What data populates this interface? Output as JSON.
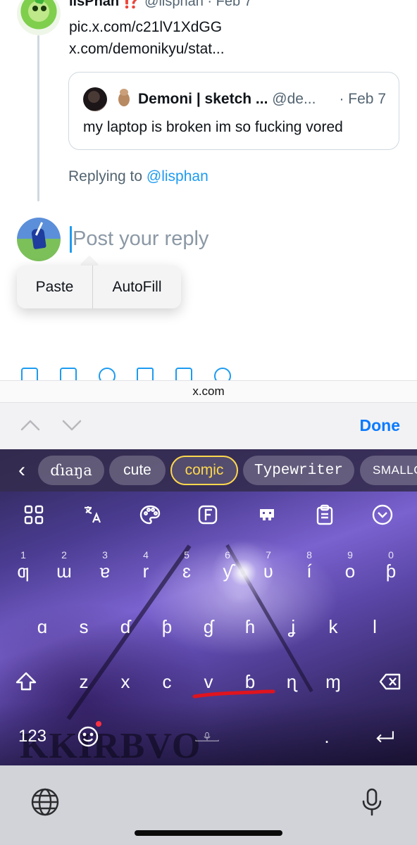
{
  "tweet": {
    "author_name": "lisPhan",
    "author_emoji": "⁉️",
    "author_meta": "@lisphan · Feb 7",
    "lines": [
      "pic.x.com/c21lV1XdGG",
      "x.com/demonikyu/stat..."
    ]
  },
  "quote": {
    "author_name": "Demoni | sketch ...",
    "handle": "@de...",
    "date": "· Feb 7",
    "text": "my laptop is broken im so fucking vored"
  },
  "replying": {
    "prefix": "Replying to ",
    "handle": "@lisphan"
  },
  "composer": {
    "placeholder": "Post your reply",
    "value": ""
  },
  "context_menu": {
    "paste": "Paste",
    "autofill": "AutoFill"
  },
  "browser": {
    "url": "x.com"
  },
  "accessory": {
    "done": "Done"
  },
  "keyboard": {
    "font_chips": [
      "ɗıaŋa",
      "cute",
      "coɱic",
      "Typewriter",
      "SMALLC"
    ],
    "selected_font": "coɱic",
    "toolbar_icons": [
      "grid-icon",
      "translate-icon",
      "palette-icon",
      "font-icon",
      "gamepad-icon",
      "clipboard-icon",
      "collapse-icon"
    ],
    "row1": [
      {
        "ch": "ƣ",
        "hint": "1"
      },
      {
        "ch": "ɯ",
        "hint": "2"
      },
      {
        "ch": "ɐ",
        "hint": "3"
      },
      {
        "ch": "r",
        "hint": "4"
      },
      {
        "ch": "ɛ",
        "hint": "5"
      },
      {
        "ch": "ƴ",
        "hint": "6"
      },
      {
        "ch": "ʋ",
        "hint": "7"
      },
      {
        "ch": "í",
        "hint": "8"
      },
      {
        "ch": "o",
        "hint": "9"
      },
      {
        "ch": "ƥ",
        "hint": "0"
      }
    ],
    "row2": [
      "ɑ",
      "s",
      "ɗ",
      "ƥ",
      "ɠ",
      "ɦ",
      "ʝ",
      "k",
      "l"
    ],
    "row3": [
      "z",
      "x",
      "c",
      "v",
      "ɓ",
      "ɳ",
      "ɱ"
    ],
    "label_123": "123",
    "period": ".",
    "watermark": "KKIRBVO"
  },
  "colors": {
    "link_blue": "#1d9bf0",
    "ios_blue": "#0a7aff",
    "selected_chip": "#ffd84d",
    "annotation_red": "#e0141e"
  }
}
